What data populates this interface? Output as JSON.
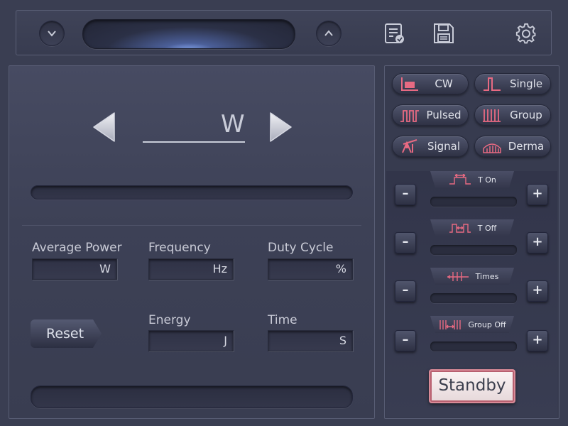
{
  "colors": {
    "accent": "#e86a82",
    "background": "#3a3e52",
    "standby_border": "#d98a97"
  },
  "topbar": {
    "icons": [
      "chevron-down-icon",
      "chevron-up-icon",
      "report-icon",
      "save-icon",
      "gear-icon"
    ]
  },
  "power": {
    "unit": "W"
  },
  "fields": {
    "average_power": {
      "label": "Average Power",
      "unit": "W"
    },
    "frequency": {
      "label": "Frequency",
      "unit": "Hz"
    },
    "duty_cycle": {
      "label": "Duty Cycle",
      "unit": "%"
    },
    "energy": {
      "label": "Energy",
      "unit": "J"
    },
    "time": {
      "label": "Time",
      "unit": "S"
    }
  },
  "reset_label": "Reset",
  "modes": [
    {
      "label": "CW",
      "icon": "cw-wave-icon"
    },
    {
      "label": "Single",
      "icon": "single-pulse-icon"
    },
    {
      "label": "Pulsed",
      "icon": "pulsed-wave-icon"
    },
    {
      "label": "Group",
      "icon": "group-pulse-icon"
    },
    {
      "label": "Signal",
      "icon": "signal-icon"
    },
    {
      "label": "Derma",
      "icon": "derma-icon"
    }
  ],
  "params": [
    {
      "label": "T  On",
      "icon": "t-on-icon",
      "minus": "–",
      "plus": "+"
    },
    {
      "label": "T  Off",
      "icon": "t-off-icon",
      "minus": "–",
      "plus": "+"
    },
    {
      "label": "Times",
      "icon": "times-icon",
      "minus": "–",
      "plus": "+"
    },
    {
      "label": "Group  Off",
      "icon": "group-off-icon",
      "minus": "–",
      "plus": "+"
    }
  ],
  "standby_label": "Standby"
}
